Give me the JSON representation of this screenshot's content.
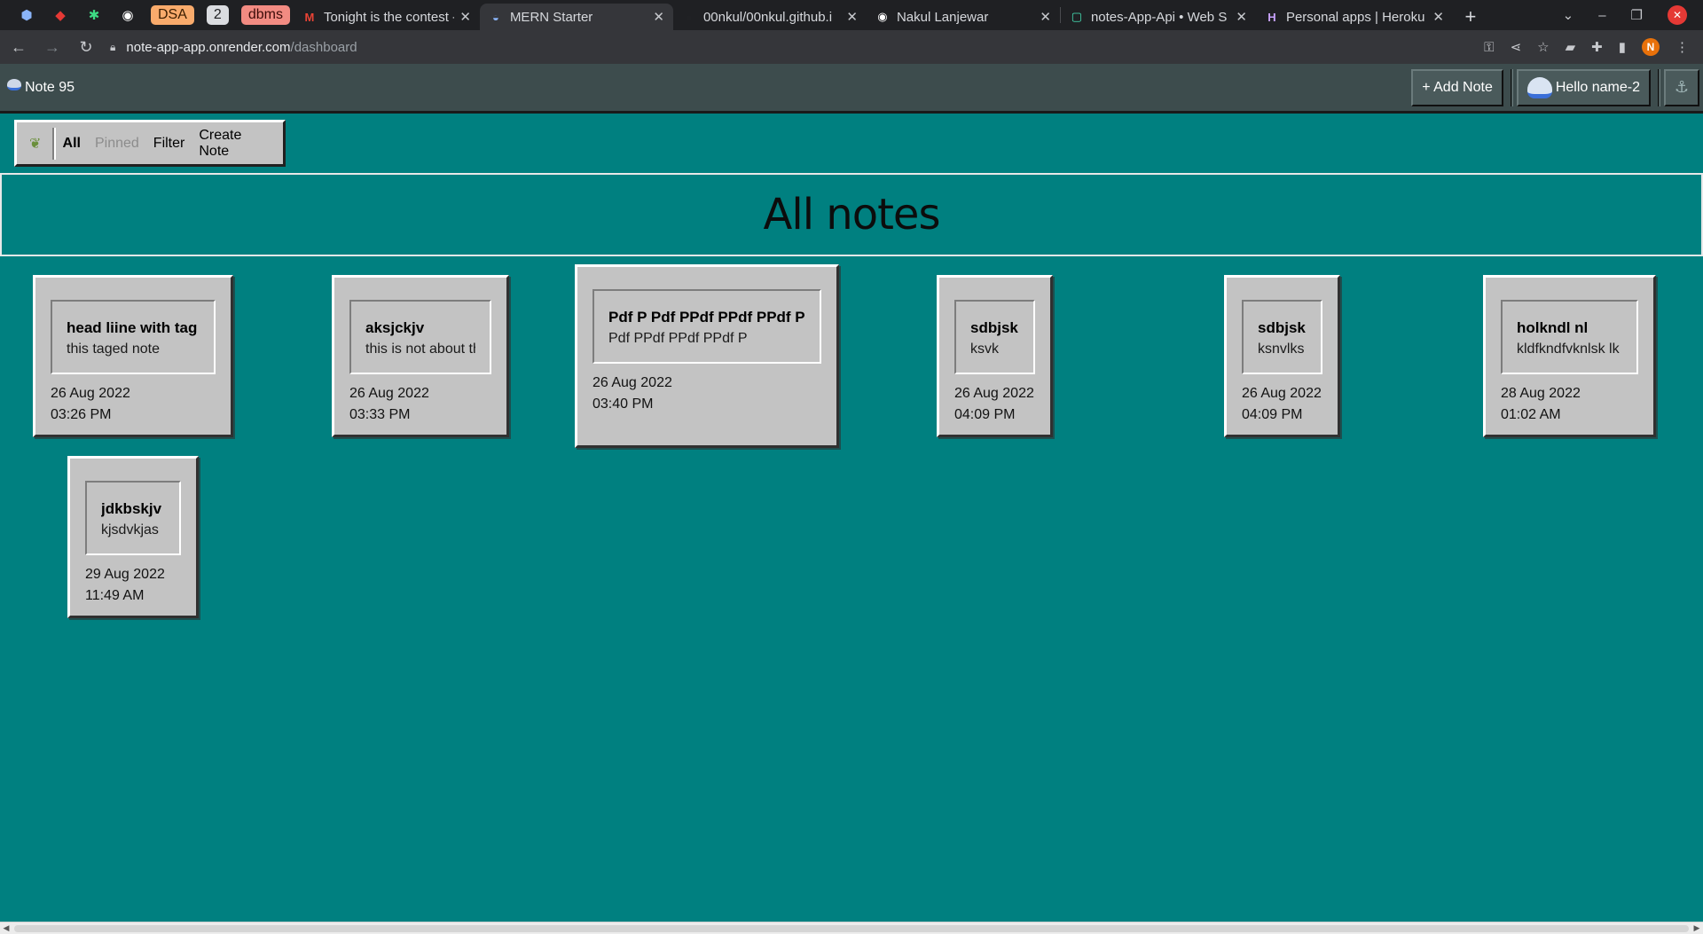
{
  "browser": {
    "pinned_tabs": [
      {
        "icon": "hexagon-icon"
      },
      {
        "icon": "red-tile-icon"
      },
      {
        "icon": "green-star-icon"
      },
      {
        "icon": "globe-icon"
      }
    ],
    "pinned_labels": [
      {
        "label": "DSA",
        "bg": "#f9ab6c",
        "fg": "#3a1d00"
      },
      {
        "label": "2",
        "bg": "#dadce0",
        "fg": "#202124"
      },
      {
        "label": "dbms",
        "bg": "#f28b82",
        "fg": "#3c0b08"
      }
    ],
    "tabs": [
      {
        "title": "Tonight is the contest -",
        "icon": "gmail-icon",
        "active": false
      },
      {
        "title": "MERN Starter",
        "icon": "app-logo-icon",
        "active": true
      },
      {
        "title": "00nkul/00nkul.github.i",
        "icon": "github-icon",
        "active": false
      },
      {
        "title": "Nakul Lanjewar",
        "icon": "globe-icon",
        "active": false
      },
      {
        "title": "notes-App-Api • Web S",
        "icon": "render-icon",
        "active": false
      },
      {
        "title": "Personal apps | Heroku",
        "icon": "heroku-icon",
        "active": false
      }
    ],
    "new_tab_label": "+",
    "url_host": "note-app-app.onrender.com",
    "url_path": "/dashboard",
    "profile_initial": "N"
  },
  "app": {
    "brand": "Note 95",
    "add_note_label": "+ Add Note",
    "user_greeting": "Hello name-2"
  },
  "filters": {
    "all": "All",
    "pinned": "Pinned",
    "filter": "Filter",
    "create": "Create Note"
  },
  "page_title": "All notes",
  "notes": [
    {
      "title": "head liine with tag",
      "body": "this taged note",
      "date": "26 Aug 2022",
      "time": "03:26 PM"
    },
    {
      "title": "aksjckjv",
      "body": "this is not about th",
      "date": "26 Aug 2022",
      "time": "03:33 PM"
    },
    {
      "title": "Pdf P Pdf PPdf PPdf PPdf P",
      "body": "Pdf PPdf PPdf PPdf P",
      "date": "26 Aug 2022",
      "time": "03:40 PM"
    },
    {
      "title": "sdbjsk",
      "body": "ksvk",
      "date": "26 Aug 2022",
      "time": "04:09 PM"
    },
    {
      "title": "sdbjsk",
      "body": "ksnvlks",
      "date": "26 Aug 2022",
      "time": "04:09 PM"
    },
    {
      "title": "holkndl nl",
      "body": "kldfkndfvknlsk lk",
      "date": "28 Aug 2022",
      "time": "01:02 AM"
    },
    {
      "title": "jdkbskjv",
      "body": "kjsdvkjas",
      "date": "29 Aug 2022",
      "time": "11:49 AM"
    }
  ],
  "colors": {
    "desktop": "#008080",
    "window_gray": "#c3c3c3",
    "header": "#3d4c4d"
  }
}
